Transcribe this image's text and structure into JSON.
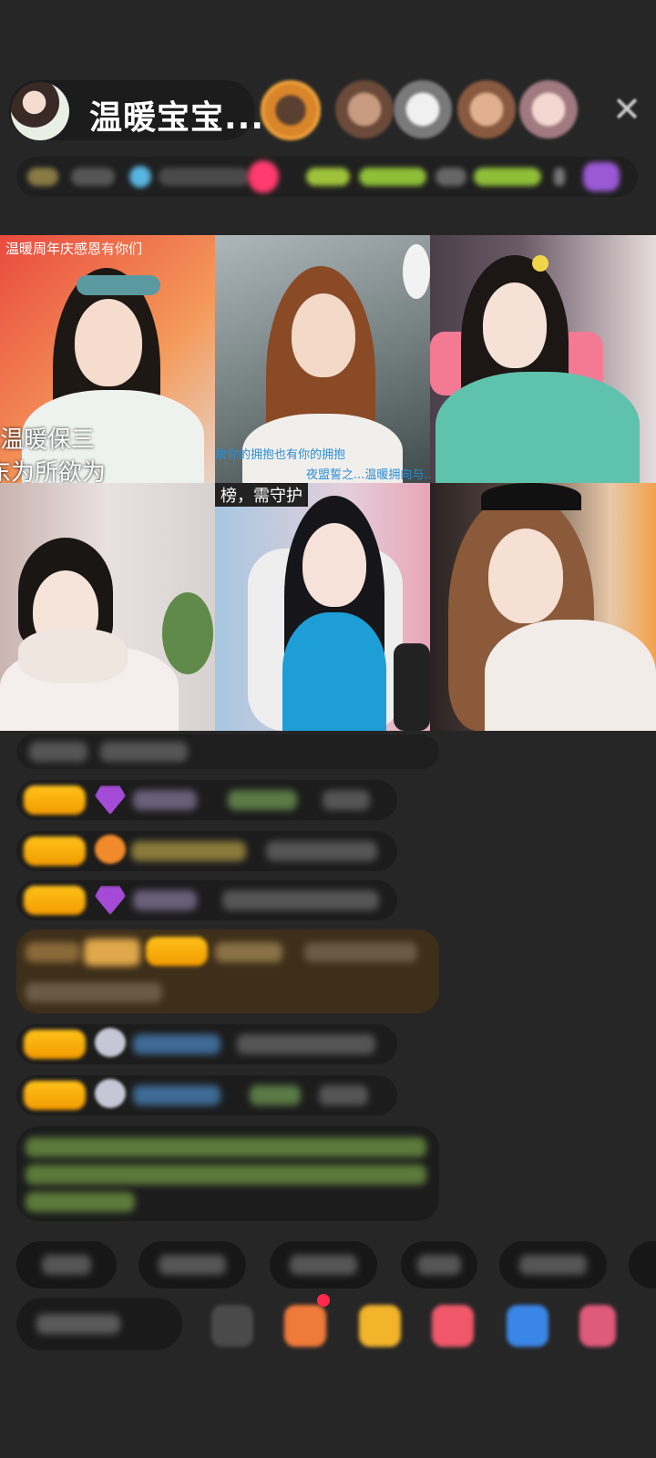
{
  "header": {
    "host_name": "温暖宝宝...",
    "close_icon": "close-icon"
  },
  "grid": {
    "tile1": {
      "banner": "温暖周年庆感恩有你们",
      "caption_line1": "温暖保三",
      "caption_line2": "东为所欲为"
    },
    "tile2": {
      "subtitle": "故你的拥抱也有你的拥抱",
      "subtitle2": "夜盟誓之...温暖拥向与..."
    },
    "tile5": {
      "banner": "榜，需守护"
    }
  },
  "colors": {
    "background": "#262626",
    "level_badge": "#ffb300",
    "green_text": "#8fd14a",
    "blue_name": "#5aa0e6"
  }
}
